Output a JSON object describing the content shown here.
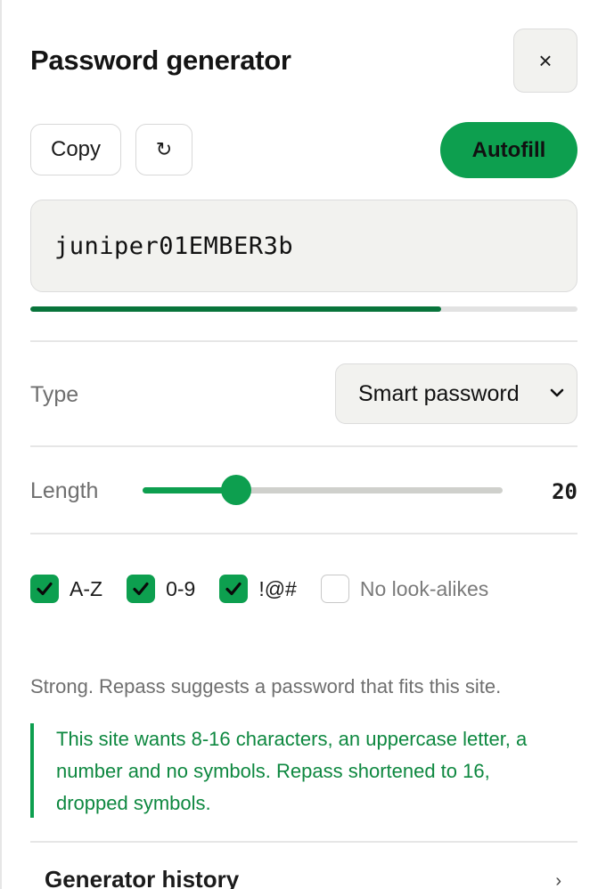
{
  "header": {
    "title": "Password generator",
    "close_icon": "×"
  },
  "actions": {
    "copy_label": "Copy",
    "regenerate_icon": "↻",
    "autofill_label": "Autofill"
  },
  "password": {
    "value": "juniper01EMBER3b",
    "strength_fraction": 0.75
  },
  "type": {
    "label": "Type",
    "selected": "Smart password"
  },
  "length": {
    "label": "Length",
    "value": 20,
    "fraction": 0.26
  },
  "options": [
    {
      "label": "A-Z",
      "checked": true
    },
    {
      "label": "0-9",
      "checked": true
    },
    {
      "label": "!@#",
      "checked": true
    },
    {
      "label": "No look-alikes",
      "checked": false
    }
  ],
  "hint": "Strong. Repass suggests a password that fits this site.",
  "notice": {
    "line1": "This site wants 8-16 characters, an uppercase letter, a",
    "line2": "number and no symbols. Repass shortened to 16,",
    "line3": "dropped symbols."
  },
  "history": {
    "label": "Generator history",
    "chevron": "›"
  },
  "colors": {
    "accent": "#0d9f4f",
    "strength": "#08743b",
    "notice_text": "#0e8840"
  }
}
